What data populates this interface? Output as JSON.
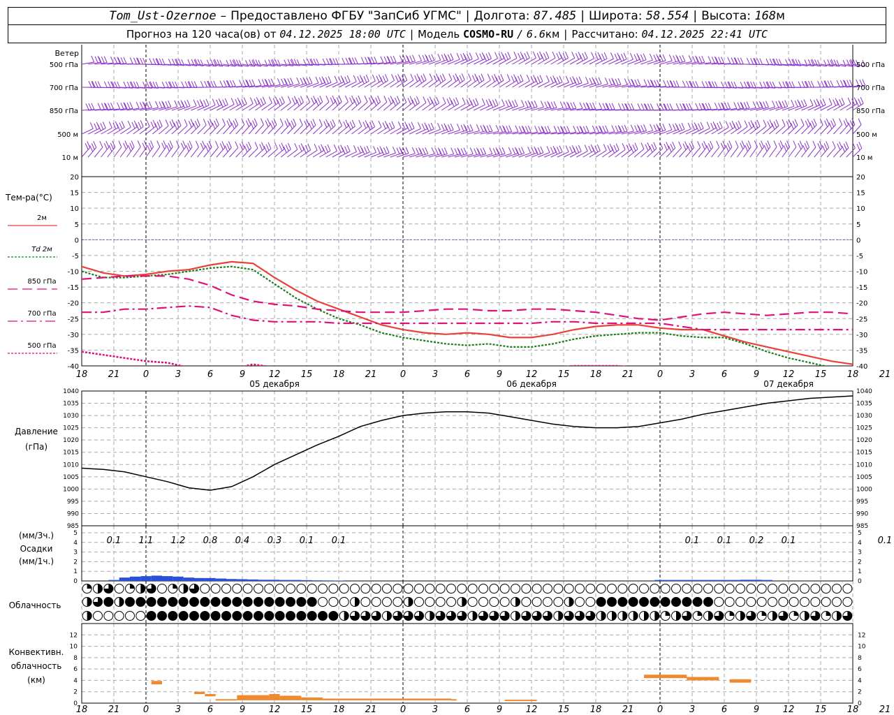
{
  "header": {
    "station": "Tom_Ust-Ozernoe",
    "dash": "–",
    "provider": "Предоставлено ФГБУ \"ЗапСиб УГМС\"",
    "lon_label": "Долгота:",
    "lon": "87.485",
    "lat_label": "Широта:",
    "lat": "58.554",
    "alt_label": "Высота:",
    "alt": "168",
    "alt_unit": "м"
  },
  "subheader": {
    "forecast_label": "Прогноз на 120 часа(ов) от",
    "forecast_time": "04.12.2025 18:00 UTC",
    "model_label": "Модель",
    "model": "COSMO-RU",
    "resolution": "6.6",
    "res_unit": "км",
    "calc_label": "Рассчитано:",
    "calc_time": "04.12.2025 22:41 UTC"
  },
  "colors": {
    "wind": "#8b32c8",
    "t2m": "#e8413a",
    "td2m": "#1e7d1e",
    "t850": "#e0107a",
    "t700": "#e0107a",
    "t500": "#e0107a",
    "zero_line": "#5a6ad8",
    "pressure": "#000000",
    "precip": "#2a4fd8",
    "convective": "#f08a30",
    "grid": "#a8a8a8"
  },
  "wind_panel": {
    "title": "Ветер",
    "levels": [
      "500 гПа",
      "700 гПа",
      "850 гПа",
      "500 м",
      "10  м"
    ]
  },
  "temp_panel": {
    "title": "Тем-ра(°C)",
    "legend": [
      {
        "label": "2м"
      },
      {
        "label": "Td  2м"
      },
      {
        "label": "850 гПа"
      },
      {
        "label": "700 гПа"
      },
      {
        "label": "500 гПа"
      }
    ]
  },
  "pressure_panel": {
    "label1": "Давление",
    "label2": "(гПа)"
  },
  "precip_panel": {
    "label1": "(мм/3ч.)",
    "label2": "Осадки",
    "label3": "(мм/1ч.)",
    "amounts": [
      {
        "h": 3,
        "v": "0.1"
      },
      {
        "h": 6,
        "v": "1.1"
      },
      {
        "h": 9,
        "v": "1.2"
      },
      {
        "h": 12,
        "v": "0.8"
      },
      {
        "h": 15,
        "v": "0.4"
      },
      {
        "h": 18,
        "v": "0.3"
      },
      {
        "h": 21,
        "v": "0.1"
      },
      {
        "h": 24,
        "v": "0.1"
      },
      {
        "h": 57,
        "v": "0.1"
      },
      {
        "h": 60,
        "v": "0.1"
      },
      {
        "h": 63,
        "v": "0.2"
      },
      {
        "h": 66,
        "v": "0.1"
      },
      {
        "h": 75,
        "v": "0.1"
      }
    ]
  },
  "cloud_panel": {
    "label": "Облачность"
  },
  "conv_panel": {
    "label1": "Конвективн.",
    "label2": "облачность",
    "label3": "(км)"
  },
  "time_axis": {
    "tick_labels": [
      "18",
      "21",
      "0",
      "3",
      "6",
      "9",
      "12",
      "15",
      "18",
      "21",
      "0",
      "3",
      "6",
      "9",
      "12",
      "15",
      "18",
      "21",
      "0",
      "3",
      "6",
      "9",
      "12",
      "15",
      "18",
      "21",
      "0"
    ],
    "day_labels": [
      {
        "h": 18,
        "text": "05 декабря"
      },
      {
        "h": 42,
        "text": "06 декабря"
      },
      {
        "h": 66,
        "text": "07 декабря"
      }
    ]
  },
  "chart_data": [
    {
      "type": "line",
      "title": "Тем-ра(°C)",
      "ylim": [
        -40,
        20
      ],
      "yticks": [
        20,
        15,
        10,
        5,
        0,
        -5,
        -10,
        -15,
        -20,
        -25,
        -30,
        -35,
        -40
      ],
      "x_hours": [
        0,
        2,
        4,
        6,
        8,
        10,
        12,
        14,
        16,
        18,
        20,
        22,
        24,
        26,
        28,
        30,
        32,
        34,
        36,
        38,
        40,
        42,
        44,
        46,
        48,
        50,
        52,
        54,
        56,
        58,
        60,
        62,
        64,
        66,
        68,
        70,
        72
      ],
      "series": [
        {
          "name": "2м",
          "values": [
            -8.5,
            -10.5,
            -11.5,
            -11,
            -10,
            -9.5,
            -8,
            -7,
            -7.5,
            -12,
            -16,
            -19.5,
            -22,
            -24.5,
            -27,
            -28.5,
            -29.5,
            -30,
            -29.5,
            -30,
            -31,
            -31,
            -30,
            -28.5,
            -27.5,
            -27,
            -27,
            -28,
            -28.5,
            -28.5,
            -30.5,
            -32.5,
            -34,
            -35.5,
            -37,
            -38.5,
            -39.5
          ]
        },
        {
          "name": "Td  2м",
          "values": [
            -10,
            -12,
            -12,
            -11.5,
            -11,
            -10,
            -9,
            -8.5,
            -9.5,
            -14,
            -18.5,
            -22,
            -25,
            -27,
            -29.5,
            -31,
            -32,
            -33,
            -33.5,
            -33,
            -34,
            -34,
            -33,
            -31.5,
            -30.5,
            -30,
            -29.5,
            -29.5,
            -30.5,
            -31,
            -31,
            -33,
            -35.5,
            -37.5,
            -39,
            -40.5,
            -42
          ]
        },
        {
          "name": "850 гПа",
          "values": [
            -12.5,
            -12,
            -11.5,
            -11.5,
            -11.5,
            -12.5,
            -14.5,
            -17.5,
            -19.5,
            -20.5,
            -21,
            -22,
            -22.5,
            -23,
            -23,
            -23,
            -22.5,
            -22,
            -22,
            -22.5,
            -22.5,
            -22,
            -22,
            -22.5,
            -23,
            -24,
            -25,
            -25.5,
            -24.5,
            -23.5,
            -23,
            -23.5,
            -24,
            -23.5,
            -23,
            -23,
            -23.5
          ]
        },
        {
          "name": "700 гПа",
          "values": [
            -23,
            -23,
            -22,
            -22,
            -21.5,
            -21,
            -21.5,
            -24,
            -25.5,
            -26,
            -26,
            -26,
            -26.5,
            -26.5,
            -26.5,
            -26.5,
            -26.5,
            -26.5,
            -26.5,
            -26.5,
            -26.5,
            -26.5,
            -26,
            -26,
            -26.5,
            -26.5,
            -26.5,
            -26.5,
            -27.5,
            -28.5,
            -28.5,
            -28.5,
            -28.5,
            -28.5,
            -28.5,
            -28.5,
            -28.5
          ]
        },
        {
          "name": "500 гПа",
          "values": [
            -35.5,
            -36.5,
            -37.5,
            -38.5,
            -39,
            -40.5,
            -42,
            -41,
            -39.5,
            -40.5,
            -42,
            -42.5,
            -43,
            -43,
            -43,
            -43,
            -43,
            -42.5,
            -42,
            -41.5,
            -41,
            -40.5,
            -40.5,
            -40,
            -40,
            -40,
            -40.5,
            -41,
            -41.5,
            -42,
            -42,
            -42.5,
            -42.5,
            -42.5,
            -42.5,
            -42.5,
            -42.5
          ]
        }
      ]
    },
    {
      "type": "line",
      "title": "Давление",
      "ylabel": "(гПа)",
      "ylim": [
        985,
        1040
      ],
      "yticks": [
        1040,
        1035,
        1030,
        1025,
        1020,
        1015,
        1010,
        1005,
        1000,
        995,
        990,
        985
      ],
      "x_hours": [
        0,
        2,
        4,
        6,
        8,
        10,
        12,
        14,
        16,
        18,
        20,
        22,
        24,
        26,
        28,
        30,
        32,
        34,
        36,
        38,
        40,
        42,
        44,
        46,
        48,
        50,
        52,
        54,
        56,
        58,
        60,
        62,
        64,
        66,
        68,
        70,
        72
      ],
      "series": [
        {
          "name": "Давление",
          "values": [
            1008.5,
            1008,
            1007,
            1005,
            1003,
            1000.5,
            999.5,
            1001,
            1005,
            1010,
            1014,
            1018,
            1021.5,
            1025.5,
            1028,
            1030,
            1031,
            1031.5,
            1031.5,
            1031,
            1029.5,
            1028,
            1026.5,
            1025.5,
            1025,
            1025,
            1025.5,
            1027,
            1028.5,
            1030.5,
            1032,
            1033.5,
            1035,
            1036,
            1037,
            1037.5,
            1038
          ]
        }
      ]
    },
    {
      "type": "bar",
      "title": "Осадки",
      "ylabel": "(мм/1ч.)",
      "ylim": [
        0,
        5
      ],
      "yticks": [
        5,
        4,
        3,
        2,
        1,
        0
      ],
      "x_hours": [
        3,
        4,
        5,
        6,
        7,
        8,
        9,
        10,
        11,
        12,
        13,
        14,
        15,
        16,
        17,
        18,
        19,
        20,
        21,
        22,
        23,
        24,
        54,
        55,
        56,
        57,
        58,
        59,
        60,
        61,
        62,
        63,
        64
      ],
      "values": [
        0.1,
        0.35,
        0.45,
        0.5,
        0.55,
        0.5,
        0.45,
        0.35,
        0.3,
        0.3,
        0.25,
        0.2,
        0.18,
        0.15,
        0.12,
        0.12,
        0.1,
        0.1,
        0.08,
        0.06,
        0.05,
        0.04,
        0.1,
        0.1,
        0.1,
        0.1,
        0.1,
        0.1,
        0.1,
        0.1,
        0.12,
        0.12,
        0.1
      ]
    },
    {
      "type": "bar",
      "title": "Конвективн. облачность",
      "ylabel": "(км)",
      "ylim": [
        0,
        14
      ],
      "yticks": [
        12,
        10,
        8,
        6,
        4,
        2,
        0
      ],
      "segments": [
        {
          "from": 6.5,
          "to": 7.5,
          "base": 3.3,
          "top": 3.9
        },
        {
          "from": 10.5,
          "to": 11.5,
          "base": 1.6,
          "top": 2.0
        },
        {
          "from": 11.5,
          "to": 12.5,
          "base": 1.2,
          "top": 1.6
        },
        {
          "from": 12.5,
          "to": 14.5,
          "base": 0.5,
          "top": 0.7
        },
        {
          "from": 14.5,
          "to": 17.5,
          "base": 0.5,
          "top": 1.4
        },
        {
          "from": 17.5,
          "to": 18.5,
          "base": 0.5,
          "top": 1.6
        },
        {
          "from": 18.5,
          "to": 20.5,
          "base": 0.5,
          "top": 1.3
        },
        {
          "from": 20.5,
          "to": 22.5,
          "base": 0.5,
          "top": 1.0
        },
        {
          "from": 22.5,
          "to": 34.5,
          "base": 0.5,
          "top": 0.8
        },
        {
          "from": 34.5,
          "to": 35,
          "base": 0.5,
          "top": 0.7
        },
        {
          "from": 39.5,
          "to": 42.5,
          "base": 0.4,
          "top": 0.6
        },
        {
          "from": 52.5,
          "to": 56.5,
          "base": 4.4,
          "top": 5.0
        },
        {
          "from": 56.5,
          "to": 59.5,
          "base": 4.0,
          "top": 4.6
        },
        {
          "from": 60.5,
          "to": 62.5,
          "base": 3.6,
          "top": 4.2
        }
      ]
    }
  ]
}
